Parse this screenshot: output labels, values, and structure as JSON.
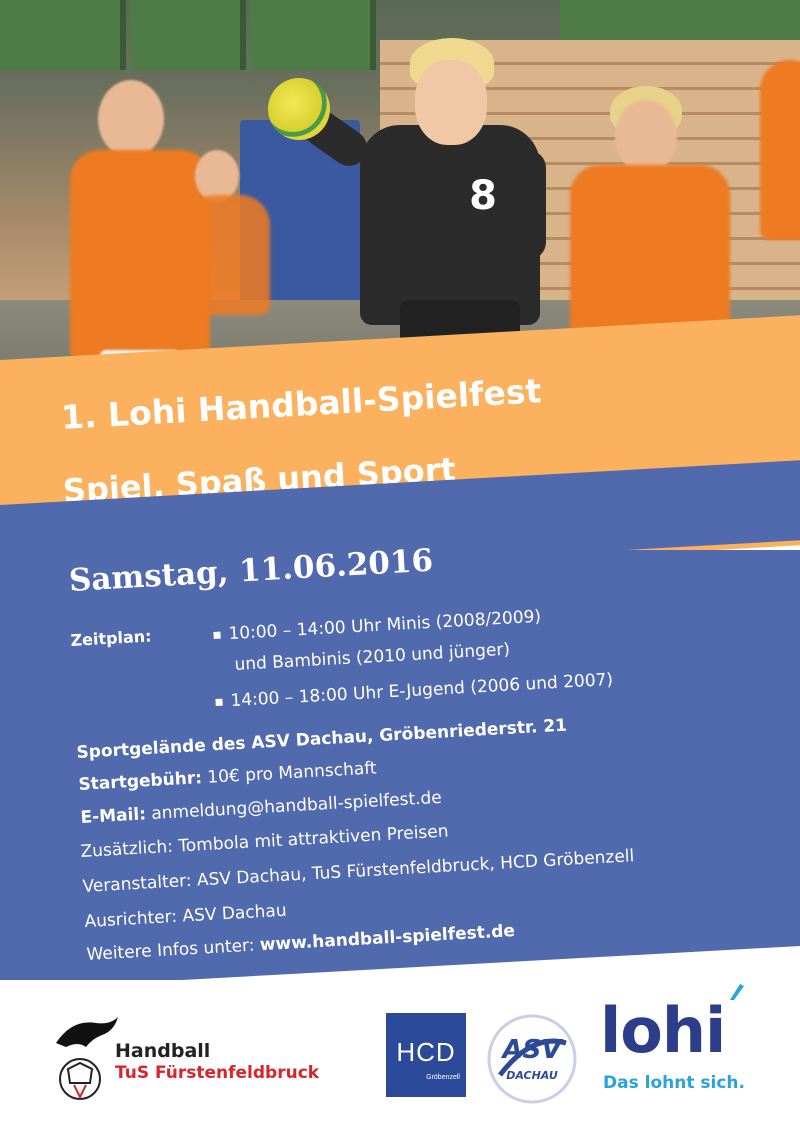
{
  "photo": {
    "jersey_number": "8"
  },
  "header": {
    "title": "1. Lohi Handball-Spielfest",
    "subtitle": "Spiel, Spaß und Sport"
  },
  "event": {
    "date": "Samstag, 11.06.2016",
    "schedule_label": "Zeitplan:",
    "schedule": [
      {
        "line1": "10:00 – 14:00 Uhr Minis (2008/2009)",
        "line2": "und Bambinis (2010 und jünger)"
      },
      {
        "line1": "14:00 – 18:00 Uhr E-Jugend (2006 und 2007)"
      }
    ],
    "venue": "Sportgelände des ASV Dachau, Gröbenriederstr. 21",
    "fee_label": "Startgebühr:",
    "fee_value": "10€ pro Mannschaft",
    "email_label": "E-Mail:",
    "email_value": "anmeldung@handball-spielfest.de",
    "extra": "Zusätzlich: Tombola mit attraktiven Preisen",
    "organizer": "Veranstalter: ASV Dachau, TuS Fürstenfeldbruck, HCD Gröbenzell",
    "host": "Ausrichter: ASV Dachau",
    "more_label": "Weitere Infos unter:",
    "more_url": "www.handball-spielfest.de"
  },
  "logos": {
    "tus": {
      "line1": "Handball",
      "line2": "TuS Fürstenfeldbruck"
    },
    "hcd": {
      "text": "HCD",
      "sub": "Gröbenzell"
    },
    "asv": {
      "text": "ASV",
      "sub": "DACHAU"
    },
    "lohi": {
      "word": "lohi",
      "tagline": "Das lohnt sich."
    }
  },
  "colors": {
    "orange_band": "#fbb15d",
    "blue_panel": "#516aae",
    "lohi_blue": "#2c3d8a",
    "lohi_tagline": "#2aa3dc",
    "tus_red": "#d8242c"
  }
}
